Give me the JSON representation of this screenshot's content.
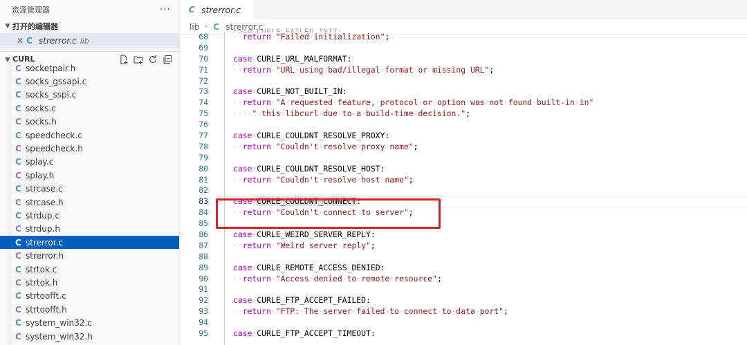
{
  "sidebar": {
    "title": "资源管理器",
    "more": "···",
    "open_editors_label": "打开的编辑器",
    "open_editor": {
      "close": "✕",
      "icon": "C",
      "name": "strerror.c",
      "dir": "lib"
    },
    "project_label": "CURL",
    "actions": [
      "new-file-icon",
      "new-folder-icon",
      "refresh-icon",
      "collapse-all-icon"
    ],
    "files": [
      {
        "name": "socketpair.h",
        "type": "h"
      },
      {
        "name": "socks_gssapi.c",
        "type": "c"
      },
      {
        "name": "socks_sspi.c",
        "type": "c"
      },
      {
        "name": "socks.c",
        "type": "c"
      },
      {
        "name": "socks.h",
        "type": "h"
      },
      {
        "name": "speedcheck.c",
        "type": "c"
      },
      {
        "name": "speedcheck.h",
        "type": "h"
      },
      {
        "name": "splay.c",
        "type": "c"
      },
      {
        "name": "splay.h",
        "type": "h"
      },
      {
        "name": "strcase.c",
        "type": "c"
      },
      {
        "name": "strcase.h",
        "type": "h"
      },
      {
        "name": "strdup.c",
        "type": "c"
      },
      {
        "name": "strdup.h",
        "type": "h"
      },
      {
        "name": "strerror.c",
        "type": "c",
        "active": true
      },
      {
        "name": "strerror.h",
        "type": "h"
      },
      {
        "name": "strtok.c",
        "type": "c"
      },
      {
        "name": "strtok.h",
        "type": "h"
      },
      {
        "name": "strtoofft.c",
        "type": "c"
      },
      {
        "name": "strtoofft.h",
        "type": "h"
      },
      {
        "name": "system_win32.c",
        "type": "c"
      },
      {
        "name": "system_win32.h",
        "type": "h"
      }
    ]
  },
  "editor": {
    "tab": {
      "icon": "C",
      "label": "strerror.c"
    },
    "breadcrumb": {
      "folder": "lib",
      "sep": "›",
      "icon": "C",
      "file": "strerror.c"
    },
    "clipped_top": "case CURLE_FAILED_INIT:",
    "lines": [
      {
        "n": "68",
        "kind": "ret",
        "text": "\"Failed initialization\""
      },
      {
        "n": "69",
        "kind": "blank"
      },
      {
        "n": "70",
        "kind": "case",
        "text": "CURLE_URL_MALFORMAT"
      },
      {
        "n": "71",
        "kind": "ret",
        "text": "\"URL using bad/illegal format or missing URL\""
      },
      {
        "n": "72",
        "kind": "blank"
      },
      {
        "n": "73",
        "kind": "case",
        "text": "CURLE_NOT_BUILT_IN"
      },
      {
        "n": "74",
        "kind": "retcont",
        "text": "\"A requested feature, protocol or option was not found built-in in\""
      },
      {
        "n": "75",
        "kind": "cont",
        "text": "\" this libcurl due to a build-time decision.\""
      },
      {
        "n": "76",
        "kind": "blank"
      },
      {
        "n": "77",
        "kind": "case",
        "text": "CURLE_COULDNT_RESOLVE_PROXY"
      },
      {
        "n": "78",
        "kind": "ret",
        "text": "\"Couldn't resolve proxy name\""
      },
      {
        "n": "79",
        "kind": "blank"
      },
      {
        "n": "80",
        "kind": "case",
        "text": "CURLE_COULDNT_RESOLVE_HOST"
      },
      {
        "n": "81",
        "kind": "ret",
        "text": "\"Couldn't resolve host name\""
      },
      {
        "n": "82",
        "kind": "blank"
      },
      {
        "n": "83",
        "kind": "case",
        "text": "CURLE_COULDNT_CONNECT",
        "current": true,
        "selected": true
      },
      {
        "n": "84",
        "kind": "ret",
        "text": "\"Couldn't connect to server\""
      },
      {
        "n": "85",
        "kind": "blank"
      },
      {
        "n": "86",
        "kind": "case",
        "text": "CURLE_WEIRD_SERVER_REPLY"
      },
      {
        "n": "87",
        "kind": "ret",
        "text": "\"Weird server reply\""
      },
      {
        "n": "88",
        "kind": "blank"
      },
      {
        "n": "89",
        "kind": "case",
        "text": "CURLE_REMOTE_ACCESS_DENIED"
      },
      {
        "n": "90",
        "kind": "ret",
        "text": "\"Access denied to remote resource\""
      },
      {
        "n": "91",
        "kind": "blank"
      },
      {
        "n": "92",
        "kind": "case",
        "text": "CURLE_FTP_ACCEPT_FAILED"
      },
      {
        "n": "93",
        "kind": "ret",
        "text": "\"FTP: The server failed to connect to data port\""
      },
      {
        "n": "94",
        "kind": "blank"
      },
      {
        "n": "95",
        "kind": "case",
        "text": "CURLE_FTP_ACCEPT_TIMEOUT"
      }
    ],
    "keywords": {
      "case": "case",
      "return": "return"
    },
    "colors": {
      "keyword": "#af00db",
      "string": "#a31515",
      "line_number": "#237893",
      "selection": "#0060c0",
      "highlight_box": "#e02020"
    }
  }
}
